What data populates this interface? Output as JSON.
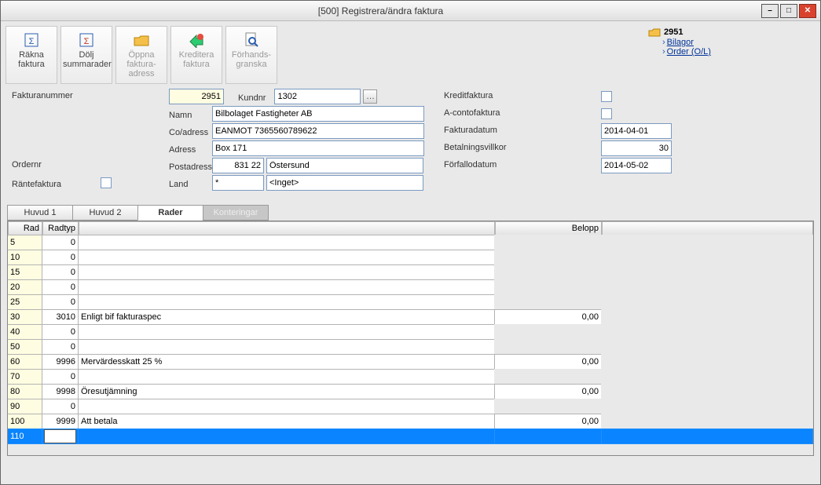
{
  "window": {
    "title": "[500]  Registrera/ändra faktura"
  },
  "toolbar": {
    "calc": {
      "label": "Räkna\nfaktura"
    },
    "hide": {
      "label": "Dölj\nsummarader"
    },
    "open": {
      "label": "Öppna\nfaktura-\nadress"
    },
    "credit": {
      "label": "Kreditera\nfaktura"
    },
    "preview": {
      "label": "Förhands-\ngranska"
    }
  },
  "nav": {
    "folder": "2951",
    "link1": "Bilagor",
    "link2": "Order (O/L)"
  },
  "labels": {
    "fakturanummer": "Fakturanummer",
    "kundnr": "Kundnr",
    "namn": "Namn",
    "coadress": "Co/adress",
    "adress": "Adress",
    "ordernr": "Ordernr",
    "postadress": "Postadress",
    "rantefaktura": "Räntefaktura",
    "land": "Land",
    "kreditfaktura": "Kreditfaktura",
    "acontofaktura": "A-contofaktura",
    "fakturadatum": "Fakturadatum",
    "betalningsvillkor": "Betalningsvillkor",
    "forfallodatum": "Förfallodatum"
  },
  "values": {
    "fakturanummer": "2951",
    "kundnr": "1302",
    "namn": "Bilbolaget Fastigheter AB",
    "coadress": "EANMOT 7365560789622",
    "adress": "Box 171",
    "ordernr": "",
    "postnr": "831 22",
    "postort": "Östersund",
    "land_code": "*",
    "land_text": "<Inget>",
    "fakturadatum": "2014-04-01",
    "betalningsvillkor": "30",
    "forfallodatum": "2014-05-02"
  },
  "tabs": {
    "t1": "Huvud 1",
    "t2": "Huvud 2",
    "t3": "Rader",
    "t4": "Konteringar"
  },
  "grid": {
    "headers": {
      "rad": "Rad",
      "radtyp": "Radtyp",
      "belopp": "Belopp"
    },
    "rows": [
      {
        "rad": "5",
        "radtyp": "0",
        "text": "",
        "belopp": ""
      },
      {
        "rad": "10",
        "radtyp": "0",
        "text": "",
        "belopp": ""
      },
      {
        "rad": "15",
        "radtyp": "0",
        "text": "",
        "belopp": ""
      },
      {
        "rad": "20",
        "radtyp": "0",
        "text": "",
        "belopp": ""
      },
      {
        "rad": "25",
        "radtyp": "0",
        "text": "",
        "belopp": ""
      },
      {
        "rad": "30",
        "radtyp": "3010",
        "text": "Enligt bif fakturaspec",
        "belopp": "0,00"
      },
      {
        "rad": "40",
        "radtyp": "0",
        "text": "",
        "belopp": ""
      },
      {
        "rad": "50",
        "radtyp": "0",
        "text": "",
        "belopp": ""
      },
      {
        "rad": "60",
        "radtyp": "9996",
        "text": "Mervärdesskatt 25 %",
        "belopp": "0,00"
      },
      {
        "rad": "70",
        "radtyp": "0",
        "text": "",
        "belopp": ""
      },
      {
        "rad": "80",
        "radtyp": "9998",
        "text": "Öresutjämning",
        "belopp": "0,00"
      },
      {
        "rad": "90",
        "radtyp": "0",
        "text": "",
        "belopp": ""
      },
      {
        "rad": "100",
        "radtyp": "9999",
        "text": "Att betala",
        "belopp": "0,00"
      }
    ],
    "editrow": {
      "rad": "110"
    }
  }
}
